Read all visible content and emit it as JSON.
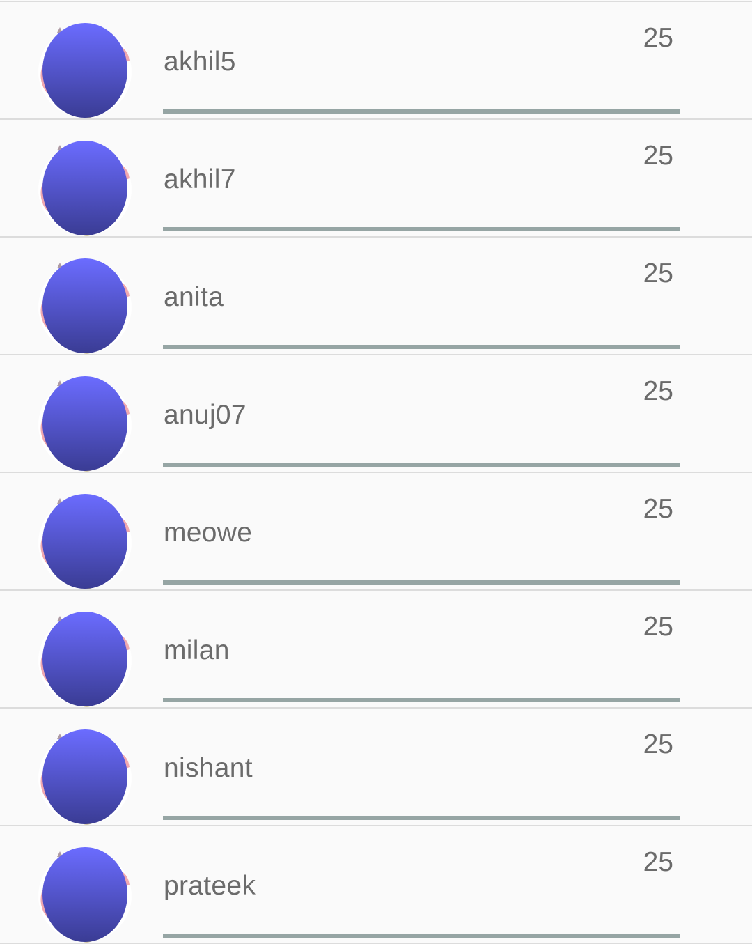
{
  "leaderboard": {
    "rows": [
      {
        "username": "akhil5",
        "score": "25",
        "progress": 1.0
      },
      {
        "username": "akhil7",
        "score": "25",
        "progress": 1.0
      },
      {
        "username": "anita",
        "score": "25",
        "progress": 1.0
      },
      {
        "username": "anuj07",
        "score": "25",
        "progress": 1.0
      },
      {
        "username": "meowe",
        "score": "25",
        "progress": 1.0
      },
      {
        "username": "milan",
        "score": "25",
        "progress": 1.0
      },
      {
        "username": "nishant",
        "score": "25",
        "progress": 1.0
      },
      {
        "username": "prateek",
        "score": "25",
        "progress": 1.0
      }
    ],
    "avatar_icon": "avatar-icon",
    "colors": {
      "avatar_top": "#6b6cff",
      "avatar_bottom": "#3a3c94",
      "avatar_back": "#f0a8b0",
      "progress_fill": "#96a5a4",
      "divider": "#dcdcdc",
      "text": "#6b6b6b"
    }
  }
}
